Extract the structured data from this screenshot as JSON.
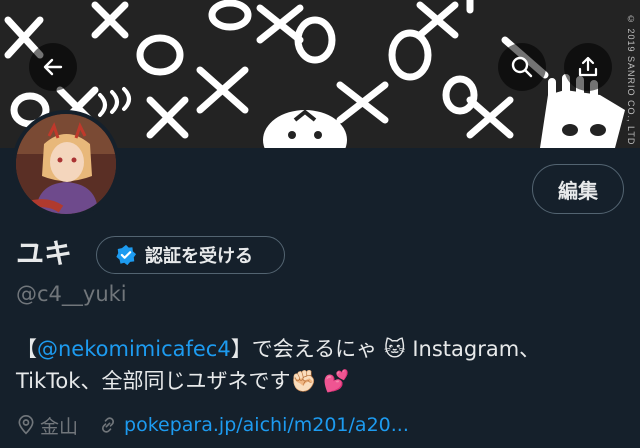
{
  "banner": {
    "copyright": "© 2019 SANRIO CO., LTD"
  },
  "header": {
    "back_icon": "arrow-left-icon",
    "search_icon": "search-icon",
    "share_icon": "share-icon"
  },
  "profile": {
    "edit_label": "編集",
    "display_name": "ユキ",
    "verify_label": "認証を受ける",
    "handle": "@c4__yuki",
    "bio_open": "【",
    "bio_mention": "@nekomimicafec4",
    "bio_line1_rest": "】で会えるにゃ 🐱 Instagram、",
    "bio_line2": "TikTok、全部同じユザネです✊🏻 💕",
    "location": "金山",
    "website": "pokepara.jp/aichi/m201/a20..."
  },
  "colors": {
    "background": "#15202b",
    "accent": "#1d9bf0",
    "secondary_text": "#71767b"
  }
}
